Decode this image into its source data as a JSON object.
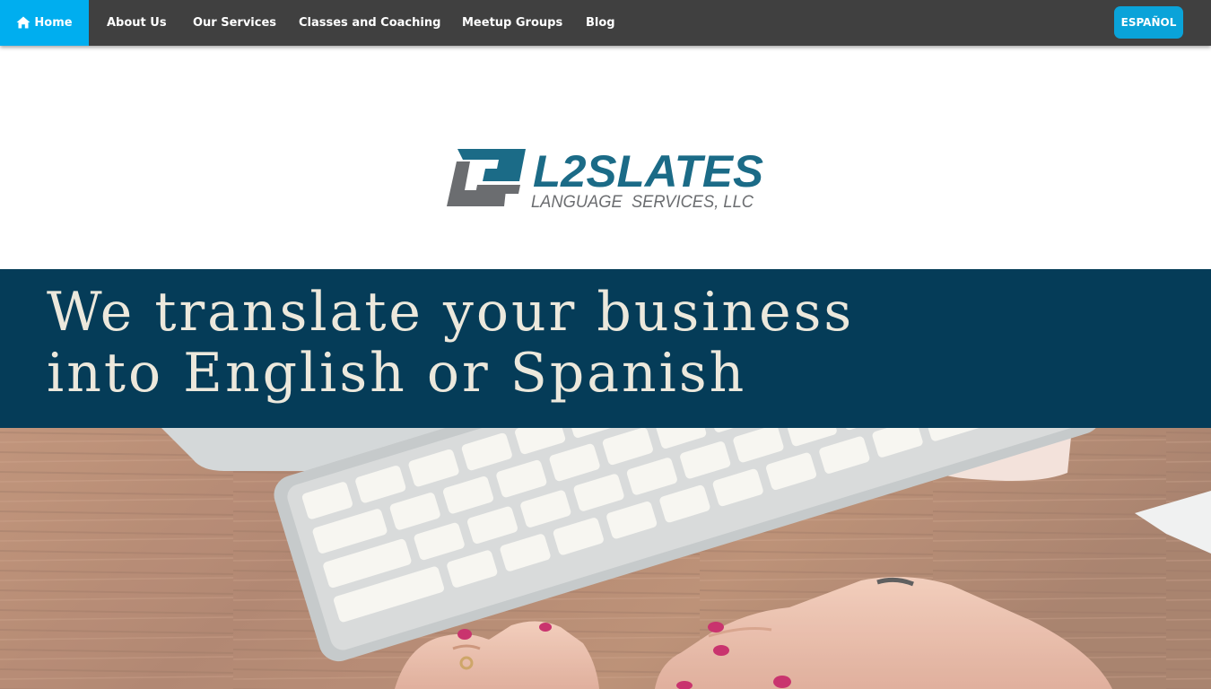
{
  "nav": {
    "home": "Home",
    "about": "About Us",
    "services": "Our Services",
    "classes": "Classes and Coaching",
    "meetup": "Meetup Groups",
    "blog": "Blog",
    "language_button": "ESPAÑOL"
  },
  "logo": {
    "name": "L2SLATES",
    "tagline": "LANGUAGE  SERVICES, LLC"
  },
  "banner": {
    "line1": "We translate your business",
    "line2": "into English or Spanish"
  },
  "colors": {
    "nav_bg": "#404040",
    "nav_active": "#00aeef",
    "button": "#0aa3d9",
    "banner_bg": "#053c58",
    "logo_teal": "#1b6b87",
    "logo_gray": "#6b6d70"
  },
  "icons": {
    "home": "home-icon"
  }
}
